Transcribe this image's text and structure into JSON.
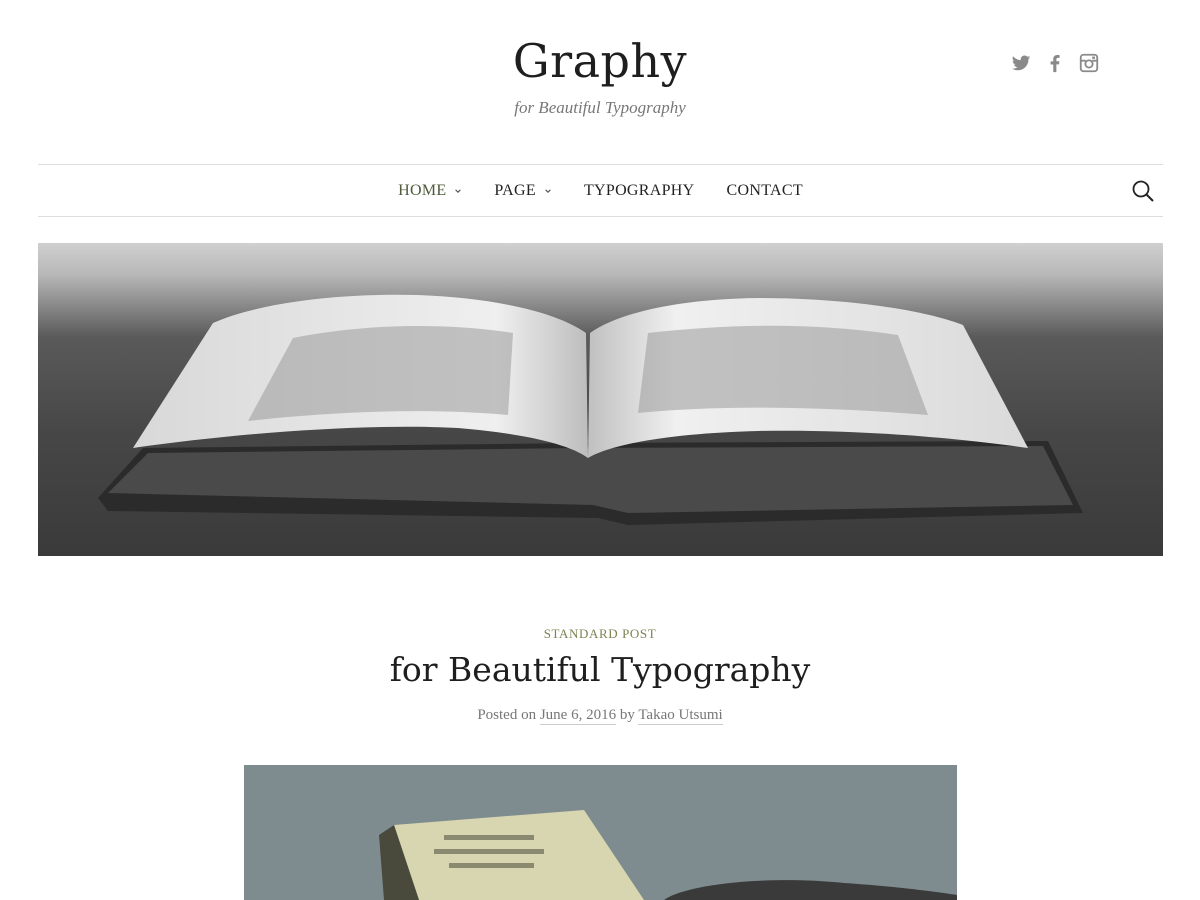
{
  "header": {
    "site_title": "Graphy",
    "tagline": "for Beautiful Typography",
    "social": [
      {
        "icon": "twitter-icon"
      },
      {
        "icon": "facebook-icon"
      },
      {
        "icon": "instagram-icon"
      }
    ]
  },
  "nav": {
    "items": [
      {
        "label": "HOME",
        "has_dropdown": true,
        "active": true
      },
      {
        "label": "PAGE",
        "has_dropdown": true,
        "active": false
      },
      {
        "label": "TYPOGRAPHY",
        "has_dropdown": false,
        "active": false
      },
      {
        "label": "CONTACT",
        "has_dropdown": false,
        "active": false
      }
    ],
    "search_icon": "search-icon"
  },
  "hero": {
    "image": "open-book-photo"
  },
  "post": {
    "category": "STANDARD POST",
    "title": "for Beautiful Typography",
    "posted_on_label": "Posted on",
    "date": "June 6, 2016",
    "by_label": "by",
    "author": "Takao Utsumi"
  },
  "featured_image": {
    "image": "featured-photo"
  },
  "colors": {
    "accent": "#7c8451",
    "active_nav": "#4e5a3a",
    "text": "#222222",
    "muted": "#777777",
    "border": "#dddddd"
  }
}
